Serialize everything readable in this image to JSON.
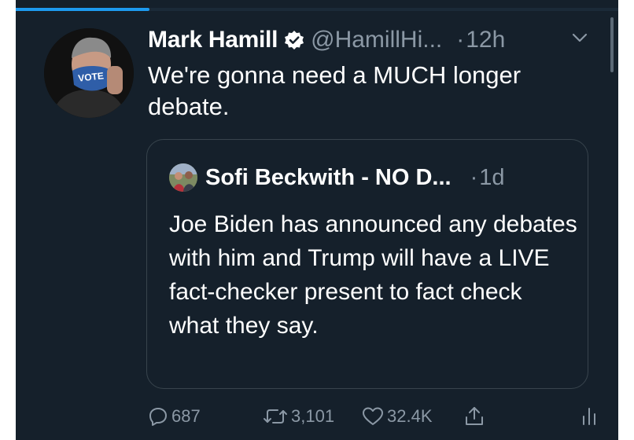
{
  "tweet": {
    "author_name": "Mark Hamill",
    "handle": "@HamillHi...",
    "dot": "·",
    "time": "12h",
    "text": "We're gonna need a MUCH longer debate.",
    "avatar_mask_text": "VOTE"
  },
  "quote": {
    "author_name": "Sofi Beckwith - NO D...",
    "dot": "·",
    "time": "1d",
    "text": "Joe Biden has announced any debates with him and Trump will have a LIVE fact-checker present to fact check what they say."
  },
  "actions": {
    "replies": "687",
    "retweets": "3,101",
    "likes": "32.4K"
  },
  "icons": {
    "verified": "verified-badge-icon",
    "caret": "chevron-down-icon",
    "reply": "reply-icon",
    "retweet": "retweet-icon",
    "like": "heart-icon",
    "share": "share-icon",
    "analytics": "analytics-icon"
  },
  "colors": {
    "background": "#15202b",
    "text_primary": "#ffffff",
    "text_secondary": "#8b98a5",
    "accent": "#1d9bf0",
    "border": "#38444d"
  }
}
